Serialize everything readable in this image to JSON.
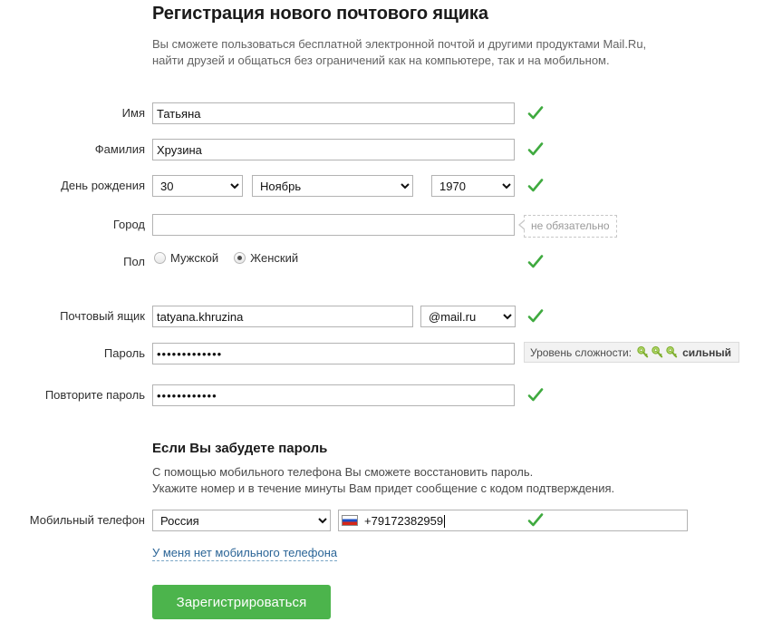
{
  "header": {
    "title": "Регистрация нового почтового ящика",
    "intro_line1": "Вы сможете пользоваться бесплатной электронной почтой и другими продуктами Mail.Ru,",
    "intro_line2": "найти друзей и общаться без ограничений как на компьютере, так и на мобильном."
  },
  "form": {
    "first_name": {
      "label": "Имя",
      "value": "Татьяна",
      "placeholder": ""
    },
    "last_name": {
      "label": "Фамилия",
      "value": "Хрузина",
      "placeholder": ""
    },
    "birthday": {
      "label": "День рождения",
      "day": "30",
      "month": "Ноябрь",
      "year": "1970",
      "day_options": [
        "30"
      ],
      "month_options": [
        "Ноябрь"
      ],
      "year_options": [
        "1970"
      ]
    },
    "city": {
      "label": "Город",
      "value": "",
      "placeholder": "",
      "hint": "не обязательно"
    },
    "gender": {
      "label": "Пол",
      "male_label": "Мужской",
      "female_label": "Женский",
      "selected": "female"
    },
    "mailbox": {
      "label": "Почтовый ящик",
      "value": "tatyana.khruzina",
      "domain": "@mail.ru",
      "domain_options": [
        "@mail.ru"
      ]
    },
    "password": {
      "label": "Пароль",
      "value": "•••••••••••••",
      "strength_label": "Уровень сложности:",
      "strength_value": "сильный",
      "strength_keys": 3
    },
    "password_repeat": {
      "label": "Повторите пароль",
      "value": "••••••••••••"
    }
  },
  "forgot": {
    "heading": "Если Вы забудете пароль",
    "line1": "С помощью мобильного телефона Вы сможете восстановить пароль.",
    "line2": "Укажите номер и в течение минуты Вам придет сообщение с кодом подтверждения."
  },
  "phone": {
    "label": "Мобильный телефон",
    "country": "Россия",
    "country_options": [
      "Россия"
    ],
    "number": "+79172382959",
    "no_phone_link": "У меня нет мобильного телефона"
  },
  "actions": {
    "submit_label": "Зарегистрироваться"
  },
  "colors": {
    "accent_green": "#4cb44c",
    "check_green": "#3faa3f",
    "link_blue": "#2a6496",
    "key_green": "#8dc63f"
  }
}
